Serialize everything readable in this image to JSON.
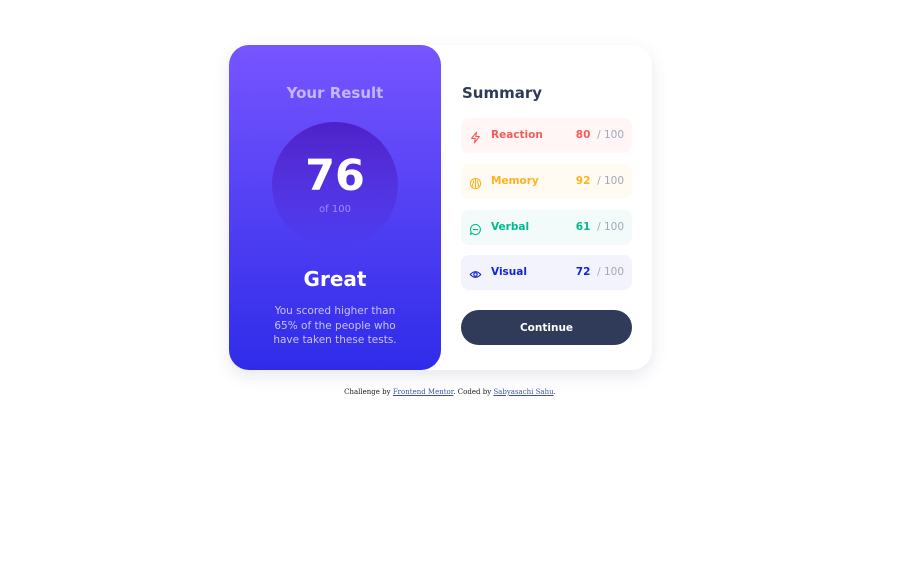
{
  "result": {
    "heading": "Your Result",
    "score": "76",
    "of_label": "of 100",
    "rating": "Great",
    "description": "You scored higher than 65% of the people who have taken these tests."
  },
  "summary": {
    "title": "Summary",
    "max_label": "/ 100",
    "items": [
      {
        "label": "Reaction",
        "value": "80",
        "icon": "lightning-icon",
        "color": "#f55b5b",
        "background": "#fff6f5"
      },
      {
        "label": "Memory",
        "value": "92",
        "icon": "brain-icon",
        "color": "#ffb21e",
        "background": "#fffbf3"
      },
      {
        "label": "Verbal",
        "value": "61",
        "icon": "chat-bubble-icon",
        "color": "#00bb8f",
        "background": "#f2fbfa"
      },
      {
        "label": "Visual",
        "value": "72",
        "icon": "eye-icon",
        "color": "#1125d6",
        "background": "#f3f3fd"
      }
    ]
  },
  "continue_label": "Continue",
  "attribution": {
    "prefix": "Challenge by ",
    "link1": "Frontend Mentor",
    "middle": ". Coded by ",
    "link2": "Sabyasachi Sahu",
    "suffix": "."
  },
  "colors": {
    "gradient_top": "#7755ff",
    "gradient_bottom": "#2f2ce9",
    "button": "#303b59"
  }
}
